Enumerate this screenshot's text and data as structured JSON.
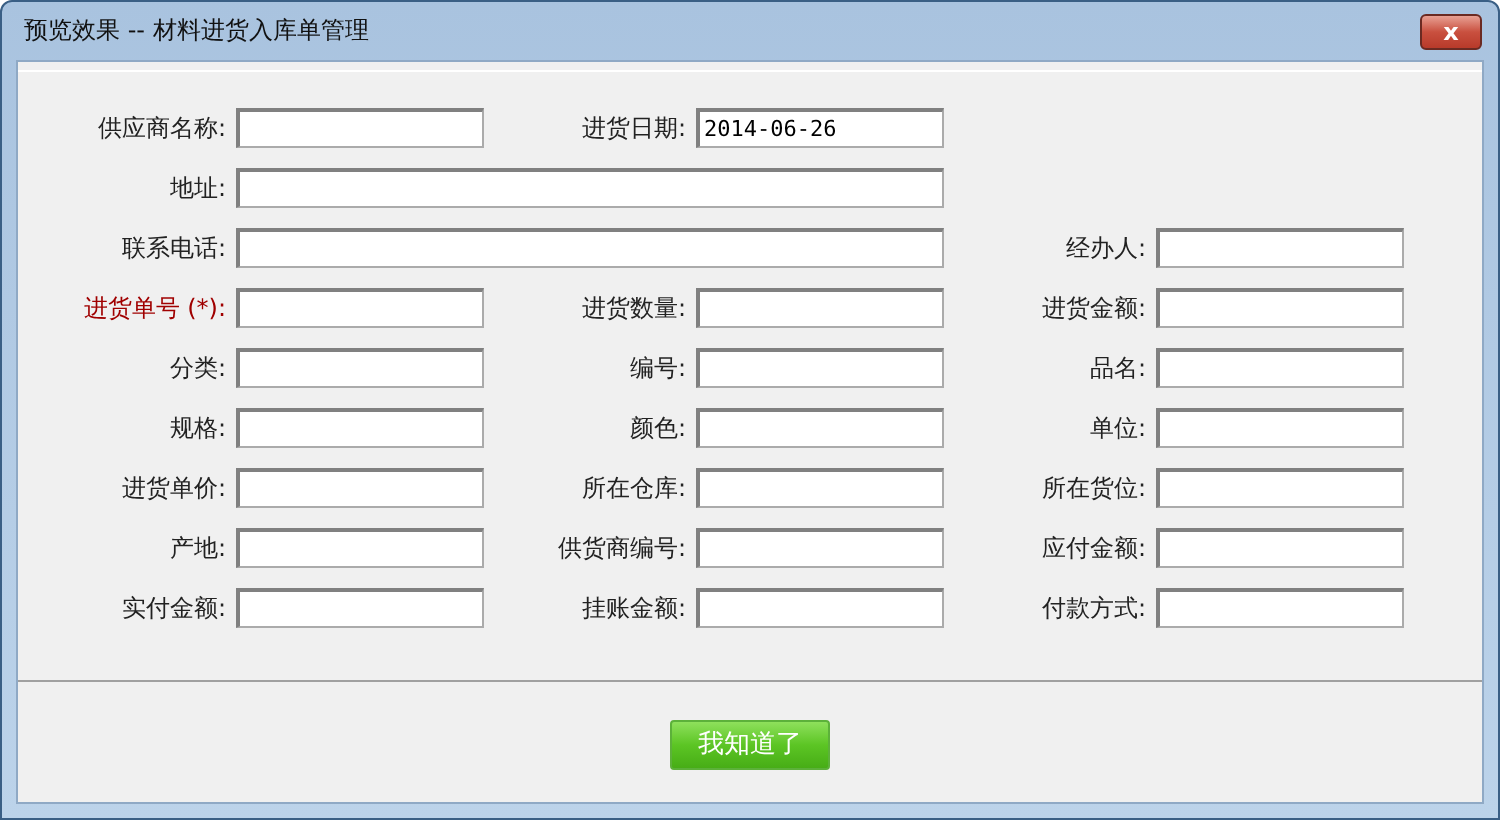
{
  "window": {
    "title": "预览效果 -- 材料进货入库单管理",
    "close_label": "x"
  },
  "rows": [
    [
      {
        "kind": "normal",
        "label": "供应商名称:",
        "required": false
      },
      {
        "kind": "normal",
        "label": "进货日期:",
        "value": "2014-06-26",
        "required": false
      }
    ],
    [
      {
        "kind": "wide",
        "label": "地址:",
        "required": false
      }
    ],
    [
      {
        "kind": "wide",
        "label": "联系电话:",
        "required": false
      },
      {
        "kind": "normal",
        "label": "经办人:",
        "required": false
      }
    ],
    [
      {
        "kind": "normal",
        "label": "进货单号 (*):",
        "required": true
      },
      {
        "kind": "normal",
        "label": "进货数量:",
        "required": false
      },
      {
        "kind": "normal",
        "label": "进货金额:",
        "required": false
      }
    ],
    [
      {
        "kind": "normal",
        "label": "分类:",
        "required": false
      },
      {
        "kind": "normal",
        "label": "编号:",
        "required": false
      },
      {
        "kind": "normal",
        "label": "品名:",
        "required": false
      }
    ],
    [
      {
        "kind": "normal",
        "label": "规格:",
        "required": false
      },
      {
        "kind": "normal",
        "label": "颜色:",
        "required": false
      },
      {
        "kind": "normal",
        "label": "单位:",
        "required": false
      }
    ],
    [
      {
        "kind": "normal",
        "label": "进货单价:",
        "required": false
      },
      {
        "kind": "normal",
        "label": "所在仓库:",
        "required": false
      },
      {
        "kind": "normal",
        "label": "所在货位:",
        "required": false
      }
    ],
    [
      {
        "kind": "normal",
        "label": "产地:",
        "required": false
      },
      {
        "kind": "normal",
        "label": "供货商编号:",
        "required": false
      },
      {
        "kind": "normal",
        "label": "应付金额:",
        "required": false
      }
    ],
    [
      {
        "kind": "normal",
        "label": "实付金额:",
        "required": false
      },
      {
        "kind": "normal",
        "label": "挂账金额:",
        "required": false
      },
      {
        "kind": "normal",
        "label": "付款方式:",
        "required": false
      }
    ]
  ],
  "ok_button": "我知道了"
}
